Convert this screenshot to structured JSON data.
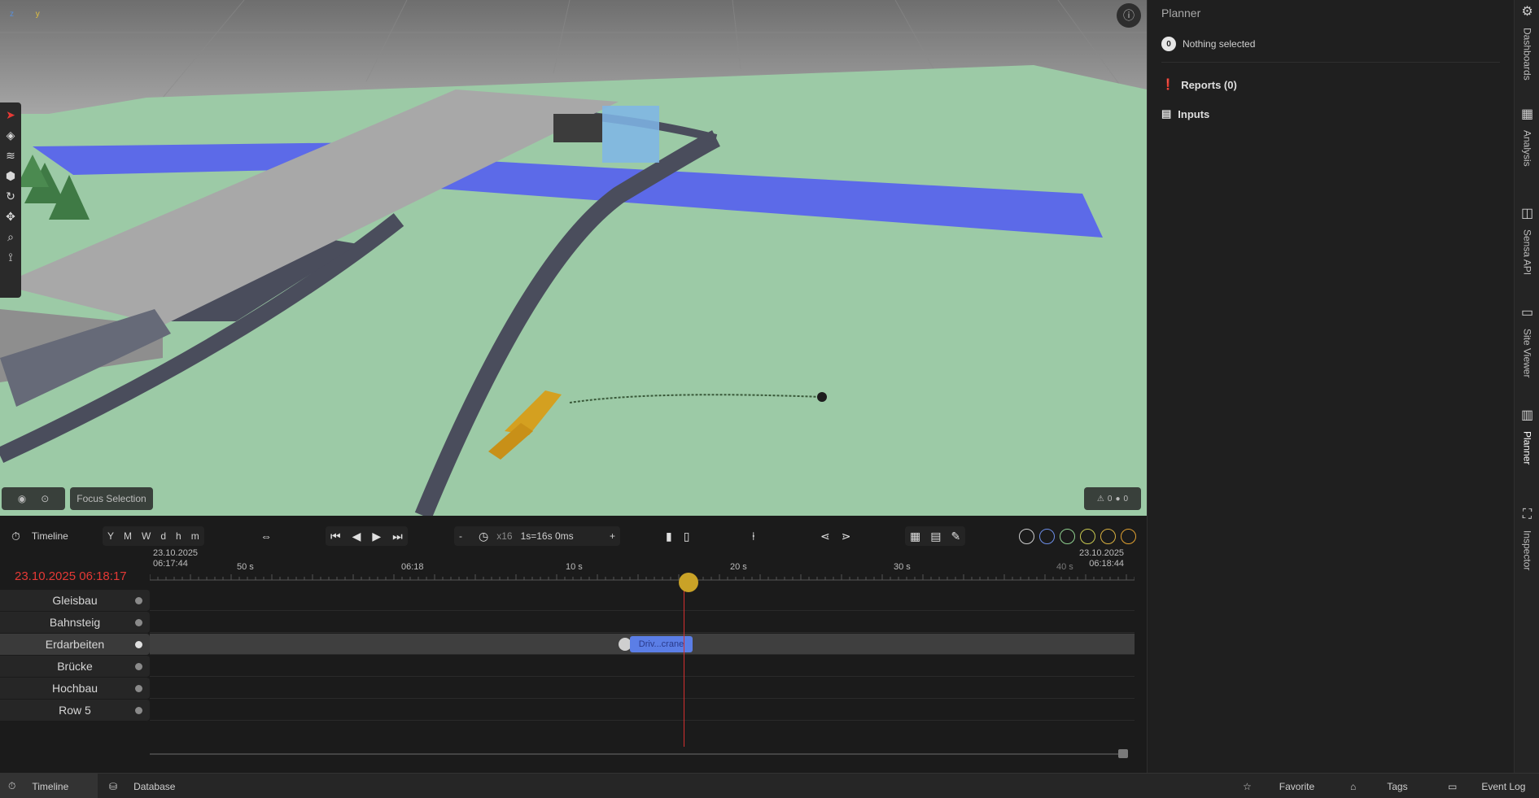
{
  "viewport": {
    "axis_labels": {
      "x": "z",
      "y": "y"
    },
    "focus_selection_label": "Focus Selection",
    "warnings_count": "0",
    "errors_count": "0",
    "colors": {
      "ground": "#9ccaa6",
      "water": "#5c6ae8",
      "road": "#4a4d5c"
    }
  },
  "planner": {
    "title": "Planner",
    "selection_count": "0",
    "selection_text": "Nothing selected",
    "reports_label": "Reports (0)",
    "inputs_label": "Inputs"
  },
  "vertical_tabs": [
    "Dashboards",
    "Analysis",
    "Sensa API",
    "Site Viewer",
    "Planner",
    "Inspector"
  ],
  "timeline": {
    "title": "Timeline",
    "zoom_units": [
      "Y",
      "M",
      "W",
      "d",
      "h",
      "m"
    ],
    "speed_minus": "-",
    "speed_plus": "+",
    "speed_multiplier": "x16",
    "speed_text": "1s=16s 0ms",
    "current_time": "23.10.2025 06:18:17",
    "range_start_date": "23.10.2025",
    "range_start_time": "06:17:44",
    "range_end_date": "23.10.2025",
    "range_end_time": "06:18:44",
    "tick_labels": [
      "50 s",
      "06:18",
      "10 s",
      "20 s",
      "30 s",
      "40 s"
    ],
    "rows": [
      {
        "name": "Gleisbau"
      },
      {
        "name": "Bahnsteig"
      },
      {
        "name": "Erdarbeiten",
        "active": true
      },
      {
        "name": "Brücke"
      },
      {
        "name": "Hochbau"
      },
      {
        "name": "Row 5"
      }
    ],
    "task_label": "Driv...crane",
    "filter_colors": [
      "#cfcfcf",
      "#6c8ee8",
      "#8fcf8f",
      "#c8c850",
      "#d8b040",
      "#e0a030"
    ]
  },
  "bottombar": {
    "timeline_label": "Timeline",
    "database_label": "Database",
    "favorite_label": "Favorite",
    "tags_label": "Tags",
    "eventlog_label": "Event Log"
  }
}
